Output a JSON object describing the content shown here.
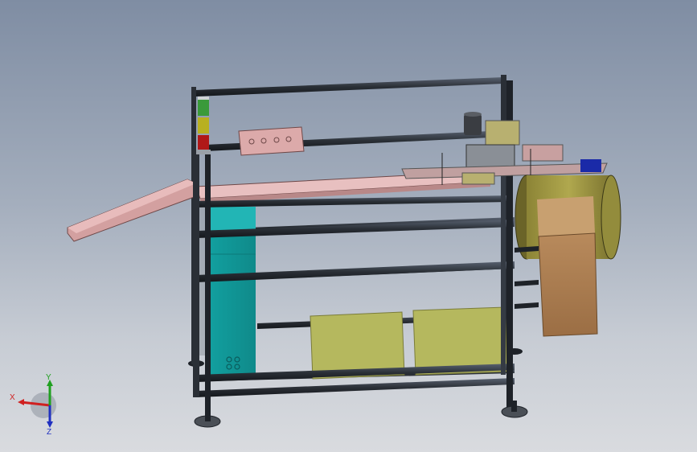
{
  "app": {
    "type": "cad-3d-viewport"
  },
  "scene": {
    "model": "conveyor-machine-frame-assembly",
    "colors": {
      "frame": "#2a2f36",
      "frame_highlight": "#5a6270",
      "chute": "#d8a8a8",
      "cabinet": "#1aa3a3",
      "panels": "#b5b85e",
      "reel": "#a8a048",
      "box": "#a97a4e",
      "stack_light_green": "#3a9a3a",
      "stack_light_yellow": "#b8b020",
      "stack_light_red": "#b01818",
      "motor": "#3a3d42",
      "blue_part": "#1a2aa8"
    }
  },
  "triad": {
    "x_label": "X",
    "y_label": "Y",
    "z_label": "Z",
    "colors": {
      "x": "#d02020",
      "y": "#20a020",
      "z": "#2030c0"
    }
  }
}
